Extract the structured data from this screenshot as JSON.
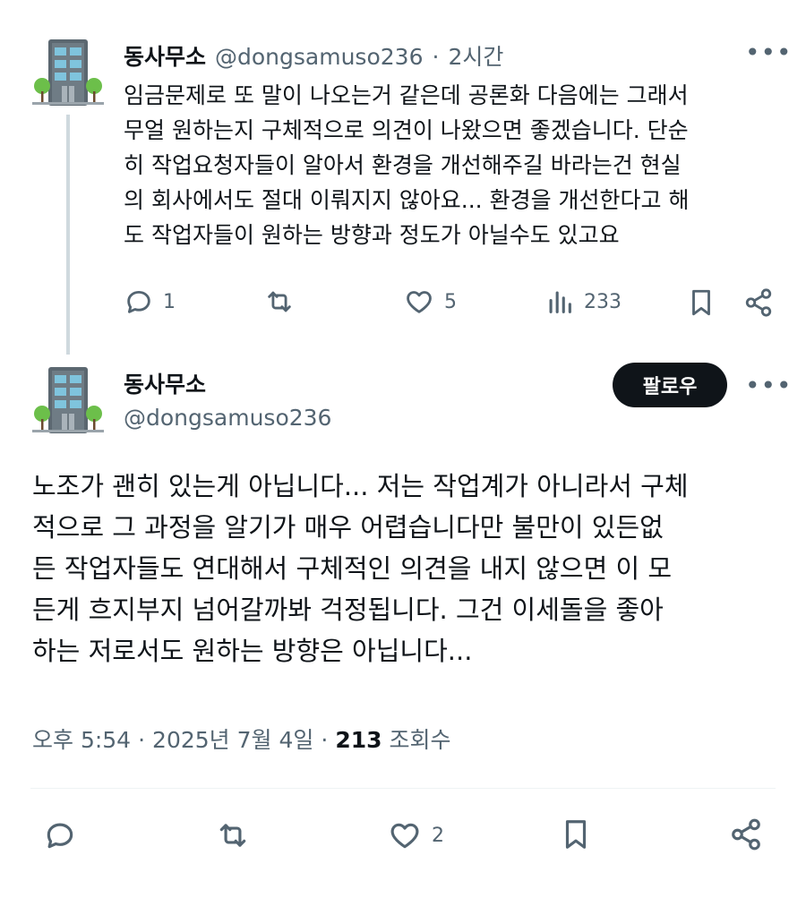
{
  "reply": {
    "display_name": "동사무소",
    "handle": "@dongsamuso236",
    "separator": "·",
    "time_ago": "2시간",
    "more": "•••",
    "lines": [
      "임금문제로 또 말이 나오는거 같은데 공론화 다음에는 그래서",
      "무얼 원하는지 구체적으로 의견이 나왔으면 좋겠습니다. 단순",
      "히 작업요청자들이 알아서 환경을 개선해주길 바라는건 현실",
      "의 회사에서도 절대 이뤄지지 않아요... 환경을 개선한다고 해",
      "도 작업자들이 원하는 방향과 정도가 아닐수도 있고요"
    ],
    "reply_count": "1",
    "like_count": "5",
    "view_count": "233"
  },
  "main": {
    "display_name": "동사무소",
    "handle": "@dongsamuso236",
    "follow_label": "팔로우",
    "more": "•••",
    "lines": [
      "노조가 괜히 있는게 아닙니다... 저는 작업계가 아니라서 구체",
      "적으로 그 과정을 알기가 매우 어렵습니다만 불만이 있든없",
      "든 작업자들도 연대해서 구체적인 의견을 내지 않으면 이 모",
      "든게 흐지부지 넘어갈까봐 걱정됩니다. 그건 이세돌을 좋아",
      "하는 저로서도 원하는 방향은 아닙니다..."
    ],
    "time": "오후 5:54",
    "date": "2025년 7월 4일",
    "sep": "·",
    "views": "213",
    "views_label": "조회수",
    "like_count": "2"
  },
  "icons": {
    "avatar": "building-icon",
    "reply": "comment-icon",
    "retweet": "retweet-icon",
    "like": "heart-icon",
    "views": "bar-chart-icon",
    "bookmark": "bookmark-icon",
    "share": "share-icon"
  },
  "colors": {
    "text": "#0f1419",
    "secondary": "#536471",
    "thread_line": "#cfd9de",
    "divider": "#eff3f4",
    "follow_bg": "#0f1419"
  }
}
